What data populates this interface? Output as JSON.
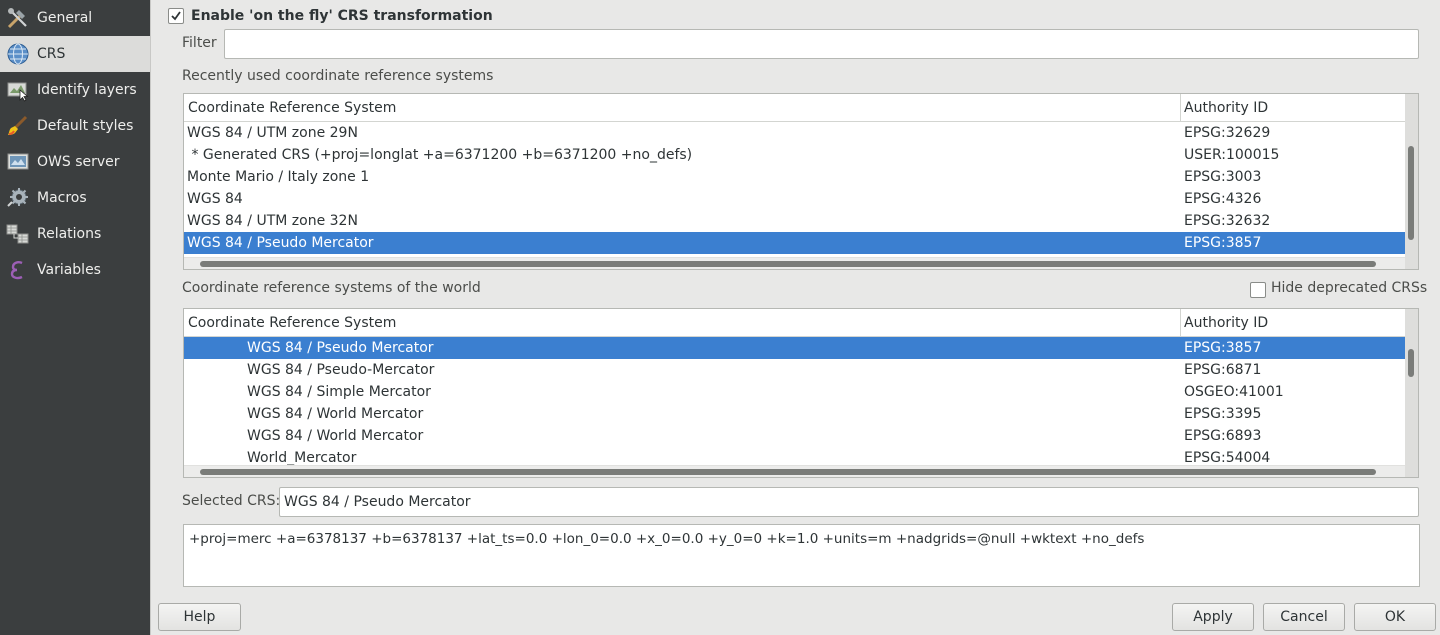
{
  "sidebar": {
    "items": [
      {
        "label": "General",
        "icon": "tools-icon"
      },
      {
        "label": "CRS",
        "icon": "globe-icon"
      },
      {
        "label": "Identify layers",
        "icon": "identify-icon"
      },
      {
        "label": "Default styles",
        "icon": "paintbrush-icon"
      },
      {
        "label": "OWS server",
        "icon": "ows-icon"
      },
      {
        "label": "Macros",
        "icon": "gear-icon"
      },
      {
        "label": "Relations",
        "icon": "relations-icon"
      },
      {
        "label": "Variables",
        "icon": "variables-icon"
      }
    ],
    "active": "CRS"
  },
  "otf": {
    "label": "Enable 'on the fly' CRS transformation",
    "checked": true
  },
  "filter": {
    "label": "Filter",
    "value": ""
  },
  "recent": {
    "title": "Recently used coordinate reference systems",
    "headers": [
      "Coordinate Reference System",
      "Authority ID"
    ],
    "rows": [
      {
        "name": "WGS 84 / UTM zone 29N",
        "id": "EPSG:32629"
      },
      {
        "name": " * Generated CRS (+proj=longlat +a=6371200 +b=6371200 +no_defs)",
        "id": "USER:100015"
      },
      {
        "name": "Monte Mario / Italy zone 1",
        "id": "EPSG:3003"
      },
      {
        "name": "WGS 84",
        "id": "EPSG:4326"
      },
      {
        "name": "WGS 84 / UTM zone 32N",
        "id": "EPSG:32632"
      },
      {
        "name": "WGS 84 / Pseudo Mercator",
        "id": "EPSG:3857"
      }
    ],
    "selected_index": 5
  },
  "world": {
    "title": "Coordinate reference systems of the world",
    "hide_deprecated": {
      "label": "Hide deprecated CRSs",
      "checked": false
    },
    "headers": [
      "Coordinate Reference System",
      "Authority ID"
    ],
    "rows": [
      {
        "name": "WGS 84 / Pseudo Mercator",
        "id": "EPSG:3857"
      },
      {
        "name": "WGS 84 / Pseudo-Mercator",
        "id": "EPSG:6871"
      },
      {
        "name": "WGS 84 / Simple Mercator",
        "id": "OSGEO:41001"
      },
      {
        "name": "WGS 84 / World Mercator",
        "id": "EPSG:3395"
      },
      {
        "name": "WGS 84 / World Mercator",
        "id": "EPSG:6893"
      },
      {
        "name": "World_Mercator",
        "id": "EPSG:54004"
      }
    ],
    "selected_index": 0
  },
  "selected_crs": {
    "label": "Selected CRS:",
    "value": "WGS 84 / Pseudo Mercator"
  },
  "proj_string": "+proj=merc +a=6378137 +b=6378137 +lat_ts=0.0 +lon_0=0.0 +x_0=0.0 +y_0=0 +k=1.0 +units=m +nadgrids=@null +wktext +no_defs",
  "buttons": {
    "help": "Help",
    "apply": "Apply",
    "cancel": "Cancel",
    "ok": "OK"
  },
  "colors": {
    "selection": "#3b7fd0",
    "sidebar_bg": "#3b3e3f"
  }
}
